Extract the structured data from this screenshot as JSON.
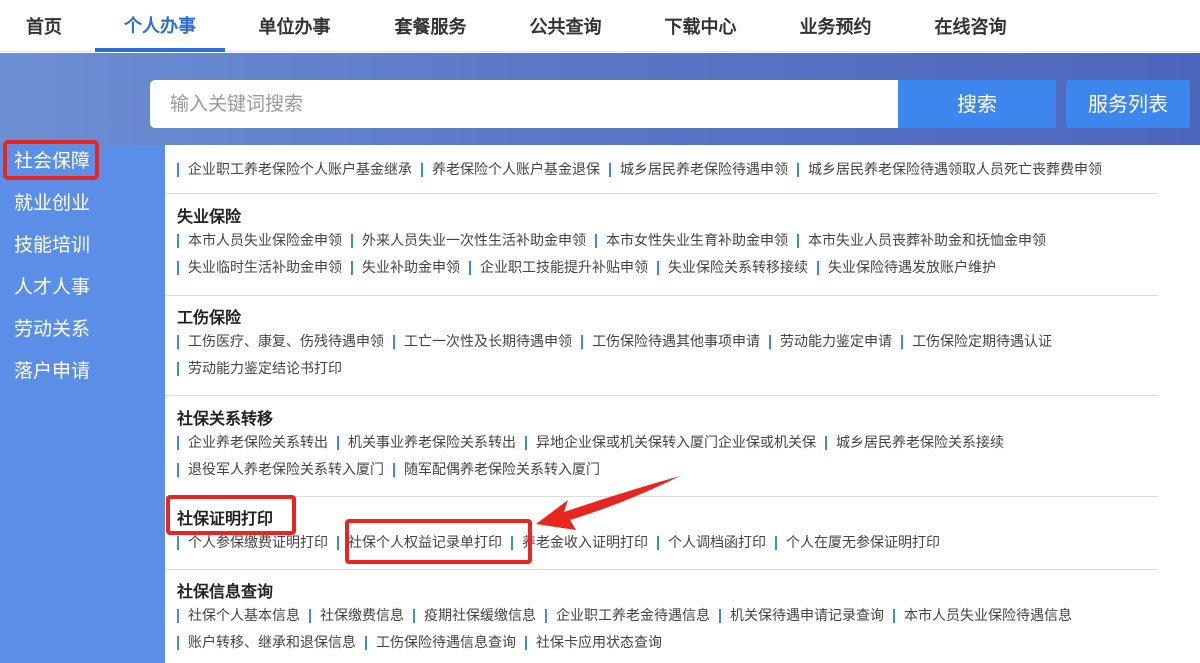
{
  "nav": {
    "items": [
      "首页",
      "个人办事",
      "单位办事",
      "套餐服务",
      "公共查询",
      "下载中心",
      "业务预约",
      "在线咨询"
    ],
    "active_index": 1
  },
  "search": {
    "placeholder": "输入关键词搜索",
    "button": "搜索",
    "service_list": "服务列表"
  },
  "sidebar": {
    "items": [
      "社会保障",
      "就业创业",
      "技能培训",
      "人才人事",
      "劳动关系",
      "落户申请"
    ],
    "active_index": 0
  },
  "sections": {
    "pension_row2": [
      "企业职工养老保险个人账户基金继承",
      "养老保险个人账户基金退保",
      "城乡居民养老保险待遇申领",
      "城乡居民养老保险待遇领取人员死亡丧葬费申领"
    ],
    "unemployment": {
      "title": "失业保险",
      "row1": [
        "本市人员失业保险金申领",
        "外来人员失业一次性生活补助金申领",
        "本市女性失业生育补助金申领",
        "本市失业人员丧葬补助金和抚恤金申领"
      ],
      "row2": [
        "失业临时生活补助金申领",
        "失业补助金申领",
        "企业职工技能提升补贴申领",
        "失业保险关系转移接续",
        "失业保险待遇发放账户维护"
      ]
    },
    "injury": {
      "title": "工伤保险",
      "row1": [
        "工伤医疗、康复、伤残待遇申领",
        "工亡一次性及长期待遇申领",
        "工伤保险待遇其他事项申请",
        "劳动能力鉴定申请",
        "工伤保险定期待遇认证"
      ],
      "row2": [
        "劳动能力鉴定结论书打印"
      ]
    },
    "transfer": {
      "title": "社保关系转移",
      "row1": [
        "企业养老保险关系转出",
        "机关事业养老保险关系转出",
        "异地企业保或机关保转入厦门企业保或机关保",
        "城乡居民养老保险关系接续"
      ],
      "row2": [
        "退役军人养老保险关系转入厦门",
        "随军配偶养老保险关系转入厦门"
      ]
    },
    "certificate": {
      "title": "社保证明打印",
      "row1": [
        "个人参保缴费证明打印",
        "社保个人权益记录单打印",
        "养老金收入证明打印",
        "个人调档函打印",
        "个人在厦无参保证明打印"
      ]
    },
    "info": {
      "title": "社保信息查询",
      "row1": [
        "社保个人基本信息",
        "社保缴费信息",
        "疫期社保缓缴信息",
        "企业职工养老金待遇信息",
        "机关保待遇申请记录查询",
        "本市人员失业保险待遇信息"
      ],
      "row2": [
        "账户转移、继承和退保信息",
        "工伤保险待遇信息查询",
        "社保卡应用状态查询"
      ]
    }
  },
  "colors": {
    "accent": "#2a6fd6",
    "sidebar": "#5b8ee6",
    "button": "#3d86ee",
    "annotation": "#e8261f",
    "link_bar": "#3a8cde"
  }
}
